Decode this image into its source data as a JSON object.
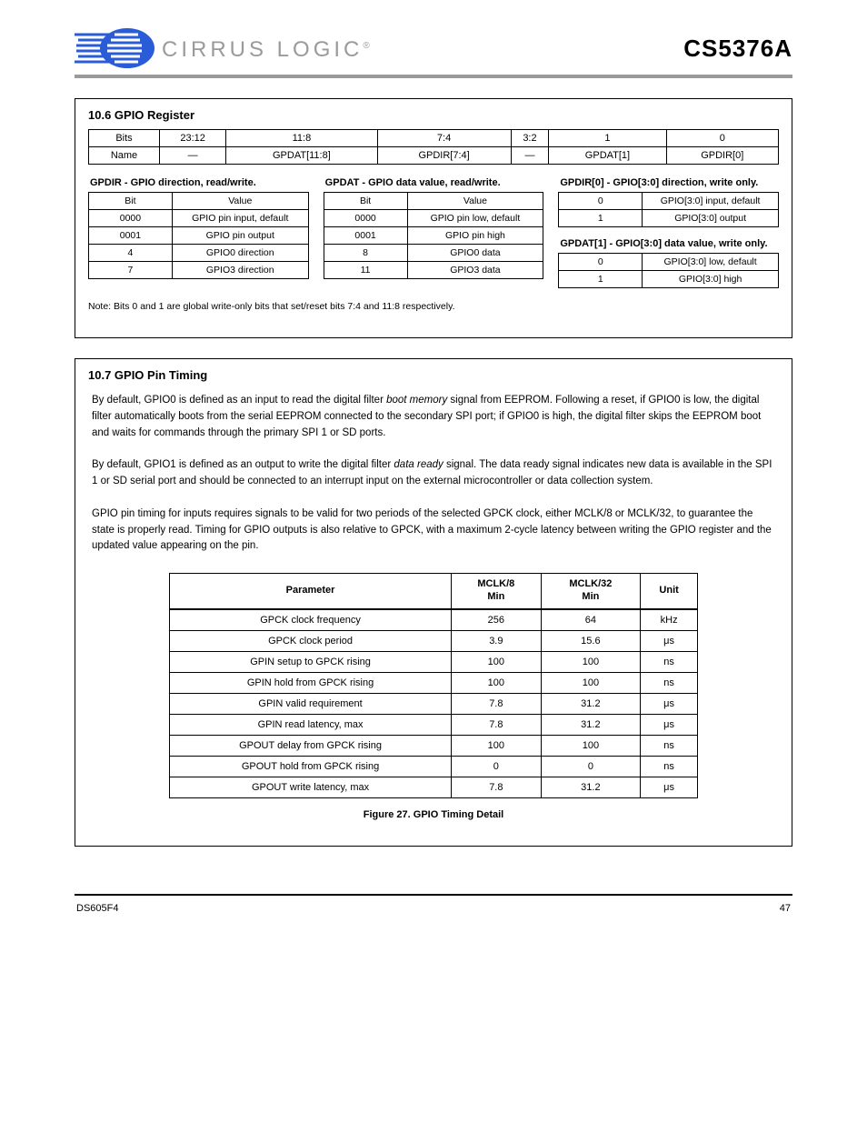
{
  "header": {
    "logo_text": "CIRRUS LOGIC",
    "trademark": "®",
    "part_number": "CS5376A"
  },
  "box1": {
    "section_title": "10.6 GPIO Register",
    "reg": {
      "rowhead_bits": "Bits",
      "rowhead_name": "Name",
      "bits": [
        "23:12",
        "11:8",
        "7:4",
        "3:2",
        "1",
        "0"
      ],
      "names": [
        "—",
        "GPDAT[11:8]",
        "GPDIR[7:4]",
        "—",
        "GPDAT[1]",
        "GPDIR[0]"
      ]
    },
    "col1": {
      "title": "GPDIR - GPIO direction, read/write.",
      "rows": [
        [
          "Bit",
          "Value"
        ],
        [
          "0000",
          "GPIO pin input, default"
        ],
        [
          "0001",
          "GPIO pin output"
        ],
        [
          "4",
          "GPIO0 direction"
        ],
        [
          "7",
          "GPIO3 direction"
        ]
      ]
    },
    "col2": {
      "title": "GPDAT - GPIO data value, read/write.",
      "rows": [
        [
          "Bit",
          "Value"
        ],
        [
          "0000",
          "GPIO pin low, default"
        ],
        [
          "0001",
          "GPIO pin high"
        ],
        [
          "8",
          "GPIO0 data"
        ],
        [
          "11",
          "GPIO3 data"
        ]
      ]
    },
    "col3a": {
      "title": "GPDIR[0] - GPIO[3:0] direction, write only.",
      "rows": [
        [
          "0",
          "GPIO[3:0] input, default"
        ],
        [
          "1",
          "GPIO[3:0] output"
        ]
      ]
    },
    "col3b": {
      "title": "GPDAT[1] - GPIO[3:0] data value, write only.",
      "rows": [
        [
          "0",
          "GPIO[3:0] low, default"
        ],
        [
          "1",
          "GPIO[3:0] high"
        ]
      ]
    },
    "note": "Note: Bits 0 and 1 are global write-only bits that set/reset bits 7:4 and 11:8 respectively."
  },
  "box2": {
    "section_title": "10.7 GPIO Pin Timing",
    "body_para1_a": "By default, GPIO0 is defined as an input to read the digital filter ",
    "body_para1_i1": "boot memory",
    "body_para1_b": " signal from EEPROM. Following a reset, if GPIO0 is low, the digital filter automatically boots from the serial EEPROM connected to the secondary SPI port; if GPIO0 is high, the digital filter skips the EEPROM boot and waits for commands through the primary SPI 1 or SD ports.",
    "body_para2_a": "By default, GPIO1 is defined as an output to write the digital filter ",
    "body_para2_i1": "data ready",
    "body_para2_b": " signal. The data ready signal indicates new data is available in the SPI 1 or SD serial port and should be connected to an interrupt input on the external microcontroller or data collection system.",
    "body_para3": "GPIO pin timing for inputs requires signals to be valid for two periods of the selected GPCK clock, either MCLK/8 or MCLK/32, to guarantee the state is properly read. Timing for GPIO outputs is also relative to GPCK, with a maximum 2-cycle latency between writing the GPIO register and the updated value appearing on the pin.",
    "table": {
      "headers": [
        "Parameter",
        "MCLK/8\nMin",
        "MCLK/32\nMin",
        "Unit"
      ],
      "rows": [
        [
          "GPCK clock frequency",
          "256",
          "64",
          "kHz"
        ],
        [
          "GPCK clock period",
          "3.9",
          "15.6",
          "μs"
        ],
        [
          "GPIN setup to GPCK rising",
          "100",
          "100",
          "ns"
        ],
        [
          "GPIN hold from GPCK rising",
          "100",
          "100",
          "ns"
        ],
        [
          "GPIN valid requirement",
          "7.8",
          "31.2",
          "μs"
        ],
        [
          "GPIN read latency, max",
          "7.8",
          "31.2",
          "μs"
        ],
        [
          "GPOUT delay from GPCK rising",
          "100",
          "100",
          "ns"
        ],
        [
          "GPOUT hold from GPCK rising",
          "0",
          "0",
          "ns"
        ],
        [
          "GPOUT write latency, max",
          "7.8",
          "31.2",
          "μs"
        ]
      ]
    },
    "figure_caption": "Figure 27. GPIO Timing Detail"
  },
  "footer": {
    "left": "DS605F4",
    "right": "47"
  }
}
